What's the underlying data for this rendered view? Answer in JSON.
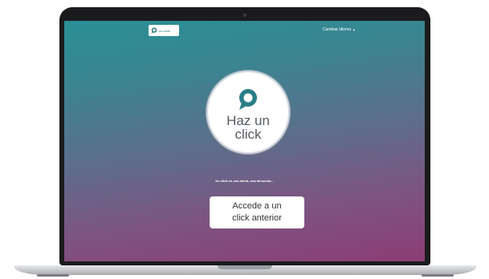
{
  "colors": {
    "accent": "#2a7e86",
    "gradient_top": "#2a8f96",
    "gradient_bottom": "#8c3d74",
    "laptop_bezel": "#1b1b1d",
    "button_bg": "#ffffff"
  },
  "header": {
    "logo_text": "co-resel",
    "logo_icon": "chat-bubble-icon",
    "language_menu": {
      "label": "Cambiar idioma",
      "icon": "caret-down-icon"
    }
  },
  "main": {
    "circle_button": {
      "icon": "chat-bubble-icon",
      "label_line1": "Haz un",
      "label_line2": "click"
    },
    "subtitle": "Un click es una alerta, una denuncia...",
    "access_button": {
      "label_line1": "Accede a un",
      "label_line2": "click anterior"
    }
  }
}
